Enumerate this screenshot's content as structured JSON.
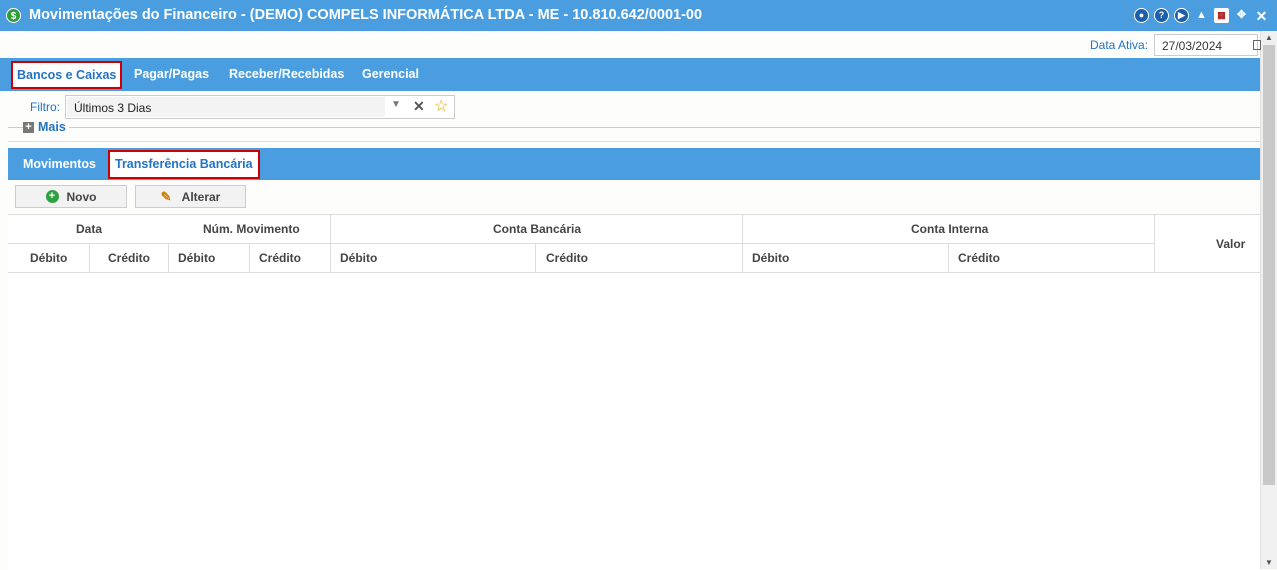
{
  "window": {
    "title": "Movimentações do Financeiro - (DEMO) COMPELS INFORMÁTICA LTDA - ME - 10.810.642/0001-00",
    "app_icon": "dollar-icon"
  },
  "window_controls": [
    "chat-icon",
    "help-icon",
    "play-icon",
    "bell-icon",
    "calendar-icon",
    "collapse-icon",
    "close-icon"
  ],
  "active_date": {
    "label": "Data Ativa:",
    "value": "27/03/2024"
  },
  "main_tabs": [
    {
      "label": "Bancos e Caixas",
      "active": true
    },
    {
      "label": "Pagar/Pagas"
    },
    {
      "label": "Receber/Recebidas"
    },
    {
      "label": "Gerencial"
    }
  ],
  "filter": {
    "label": "Filtro:",
    "value": "Últimos 3 Dias"
  },
  "more": {
    "label": "Mais"
  },
  "sub_tabs": [
    {
      "label": "Movimentos"
    },
    {
      "label": "Transferência Bancária",
      "active": true
    }
  ],
  "toolbar": {
    "new_label": "Novo",
    "edit_label": "Alterar"
  },
  "table": {
    "group_headers": [
      "Data",
      "Núm. Movimento",
      "Conta Bancária",
      "Conta Interna",
      "Valor"
    ],
    "sub_headers": [
      "Débito",
      "Crédito",
      "Débito",
      "Crédito",
      "Débito",
      "Crédito",
      "Débito",
      "Crédito"
    ],
    "rows": []
  },
  "colors": {
    "primary": "#4a9ee0",
    "accent_text": "#2273c4",
    "highlight": "#cc0000"
  }
}
